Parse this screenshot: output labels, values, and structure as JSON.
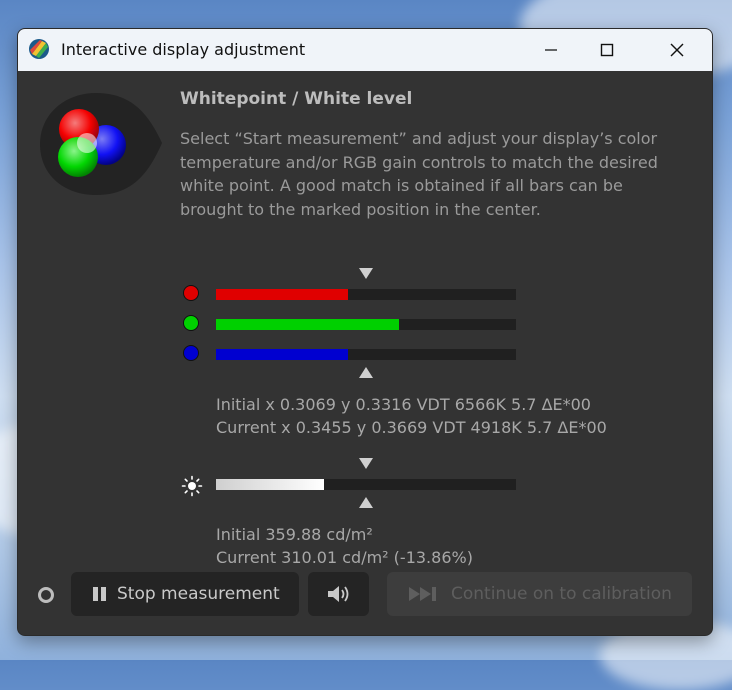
{
  "window": {
    "title": "Interactive display adjustment"
  },
  "controls": {
    "minimize_icon": "minimize-icon",
    "maximize_icon": "maximize-icon",
    "close_icon": "close-icon"
  },
  "header": {
    "title": "Whitepoint / White level",
    "description": "Select “Start measurement” and adjust your display’s color temperature and/or RGB gain controls to match the desired white point. A good match is obtained if all bars can be brought to the marked position in the center."
  },
  "rgb_bars": [
    {
      "channel": "red",
      "color": "#e00000",
      "level": 0.44
    },
    {
      "channel": "green",
      "color": "#00d000",
      "level": 0.61
    },
    {
      "channel": "blue",
      "color": "#0000d0",
      "level": 0.44
    }
  ],
  "whitepoint": {
    "initial": "Initial x 0.3069 y 0.3316 VDT 6566K 5.7 ΔE*00",
    "current": "Current x 0.3455 y 0.3669 VDT 4918K 5.7 ΔE*00"
  },
  "luminance": {
    "level": 0.36,
    "initial": "Initial 359.88 cd/m²",
    "current": "Current 310.01 cd/m² (-13.86%)"
  },
  "buttons": {
    "stop_label": "Stop measurement",
    "sound_icon": "speaker-icon",
    "continue_label": "Continue on to calibration"
  }
}
